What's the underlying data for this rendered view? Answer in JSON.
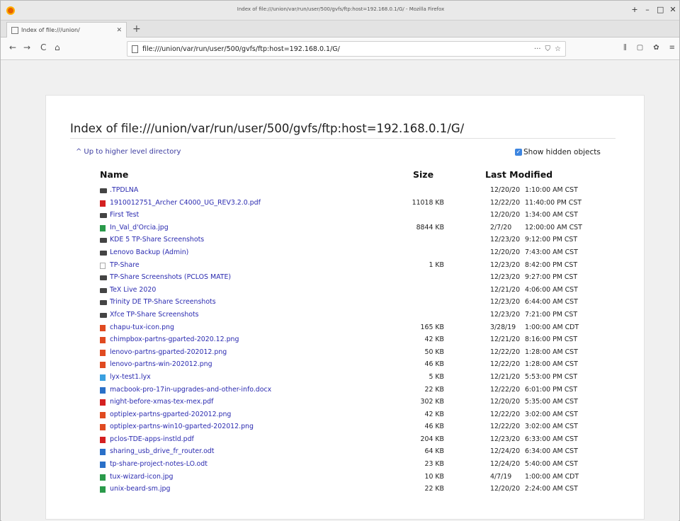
{
  "window": {
    "title": "Index of file:///union/var/run/user/500/gvfs/ftp:host=192.168.0.1/G/ - Mozilla Firefox",
    "controls": [
      "+",
      "–",
      "□",
      "✕"
    ]
  },
  "tab": {
    "label": "Index of file:///union/",
    "close": "✕",
    "new_tab": "+"
  },
  "nav": {
    "back": "←",
    "forward": "→",
    "reload": "C",
    "home": "⌂",
    "url": "file:///union/var/run/user/500/gvfs/ftp:host=192.168.0.1/G/",
    "page_actions": [
      "···",
      "⛉",
      "☆"
    ],
    "toolbar_right": [
      "⫼",
      "▢",
      "✿",
      "≡"
    ]
  },
  "page": {
    "title": "Index of file:///union/var/run/user/500/gvfs/ftp:host=192.168.0.1/G/",
    "up_link": "Up to higher level directory",
    "up_arrow": "^",
    "show_hidden": "Show hidden objects",
    "columns": {
      "name": "Name",
      "size": "Size",
      "modified": "Last Modified"
    }
  },
  "colors": {
    "folder": "#444444",
    "pdf": "#d42020",
    "image": "#2a9a4a",
    "doc": "#2a70c8",
    "png": "#e04a20",
    "text": "#aaaaaa",
    "link": "#2b2bb0"
  },
  "files": [
    {
      "name": ".TPDLNA",
      "size": "",
      "date": "12/20/20",
      "time": "1:10:00 AM CST",
      "icon": "folder-icon",
      "color": "#444444"
    },
    {
      "name": "1910012751_Archer C4000_UG_REV3.2.0.pdf",
      "size": "11018 KB",
      "date": "12/22/20",
      "time": "11:40:00 PM CST",
      "icon": "pdf-icon",
      "color": "#d42020"
    },
    {
      "name": "First Test",
      "size": "",
      "date": "12/20/20",
      "time": "1:34:00 AM CST",
      "icon": "folder-icon",
      "color": "#444444"
    },
    {
      "name": "In_Val_d'Orcia.jpg",
      "size": "8844 KB",
      "date": "2/7/20",
      "time": "12:00:00 AM CST",
      "icon": "image-icon",
      "color": "#2a9a4a"
    },
    {
      "name": "KDE 5 TP-Share Screenshots",
      "size": "",
      "date": "12/23/20",
      "time": "9:12:00 PM CST",
      "icon": "folder-icon",
      "color": "#444444"
    },
    {
      "name": "Lenovo Backup (Admin)",
      "size": "",
      "date": "12/20/20",
      "time": "7:43:00 AM CST",
      "icon": "folder-icon",
      "color": "#444444"
    },
    {
      "name": "TP-Share",
      "size": "1 KB",
      "date": "12/23/20",
      "time": "8:42:00 PM CST",
      "icon": "text-file-icon",
      "color": "#aaaaaa"
    },
    {
      "name": "TP-Share Screenshots (PCLOS MATE)",
      "size": "",
      "date": "12/23/20",
      "time": "9:27:00 PM CST",
      "icon": "folder-icon",
      "color": "#444444"
    },
    {
      "name": "TeX Live 2020",
      "size": "",
      "date": "12/21/20",
      "time": "4:06:00 AM CST",
      "icon": "folder-icon",
      "color": "#444444"
    },
    {
      "name": "Trinity DE TP-Share Screenshots",
      "size": "",
      "date": "12/23/20",
      "time": "6:44:00 AM CST",
      "icon": "folder-icon",
      "color": "#444444"
    },
    {
      "name": "Xfce TP-Share Screenshots",
      "size": "",
      "date": "12/23/20",
      "time": "7:21:00 PM CST",
      "icon": "folder-icon",
      "color": "#444444"
    },
    {
      "name": "chapu-tux-icon.png",
      "size": "165 KB",
      "date": "3/28/19",
      "time": "1:00:00 AM CDT",
      "icon": "png-icon",
      "color": "#e04a20"
    },
    {
      "name": "chimpbox-partns-gparted-2020.12.png",
      "size": "42 KB",
      "date": "12/21/20",
      "time": "8:16:00 PM CST",
      "icon": "png-icon",
      "color": "#e04a20"
    },
    {
      "name": "lenovo-partns-gparted-202012.png",
      "size": "50 KB",
      "date": "12/22/20",
      "time": "1:28:00 AM CST",
      "icon": "png-icon",
      "color": "#e04a20"
    },
    {
      "name": "lenovo-partns-win-202012.png",
      "size": "46 KB",
      "date": "12/22/20",
      "time": "1:28:00 AM CST",
      "icon": "png-icon",
      "color": "#e04a20"
    },
    {
      "name": "lyx-test1.lyx",
      "size": "5 KB",
      "date": "12/21/20",
      "time": "5:53:00 PM CST",
      "icon": "lyx-icon",
      "color": "#3aa0e0"
    },
    {
      "name": "macbook-pro-17in-upgrades-and-other-info.docx",
      "size": "22 KB",
      "date": "12/22/20",
      "time": "6:01:00 PM CST",
      "icon": "docx-icon",
      "color": "#2a70c8"
    },
    {
      "name": "night-before-xmas-tex-mex.pdf",
      "size": "302 KB",
      "date": "12/20/20",
      "time": "5:35:00 AM CST",
      "icon": "pdf-icon",
      "color": "#d42020"
    },
    {
      "name": "optiplex-partns-gparted-202012.png",
      "size": "42 KB",
      "date": "12/22/20",
      "time": "3:02:00 AM CST",
      "icon": "png-icon",
      "color": "#e04a20"
    },
    {
      "name": "optiplex-partns-win10-gparted-202012.png",
      "size": "46 KB",
      "date": "12/22/20",
      "time": "3:02:00 AM CST",
      "icon": "png-icon",
      "color": "#e04a20"
    },
    {
      "name": "pclos-TDE-apps-instld.pdf",
      "size": "204 KB",
      "date": "12/23/20",
      "time": "6:33:00 AM CST",
      "icon": "pdf-icon",
      "color": "#d42020"
    },
    {
      "name": "sharing_usb_drive_fr_router.odt",
      "size": "64 KB",
      "date": "12/24/20",
      "time": "6:34:00 AM CST",
      "icon": "odt-icon",
      "color": "#2a70c8"
    },
    {
      "name": "tp-share-project-notes-LO.odt",
      "size": "23 KB",
      "date": "12/24/20",
      "time": "5:40:00 AM CST",
      "icon": "odt-icon",
      "color": "#2a70c8"
    },
    {
      "name": "tux-wizard-icon.jpg",
      "size": "10 KB",
      "date": "4/7/19",
      "time": "1:00:00 AM CDT",
      "icon": "image-icon",
      "color": "#2a9a4a"
    },
    {
      "name": "unix-beard-sm.jpg",
      "size": "22 KB",
      "date": "12/20/20",
      "time": "2:24:00 AM CST",
      "icon": "image-icon",
      "color": "#2a9a4a"
    }
  ]
}
